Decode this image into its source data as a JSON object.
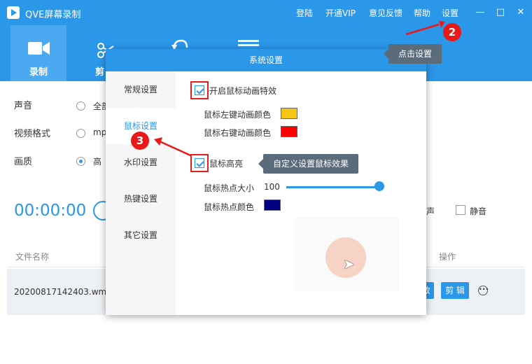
{
  "app": {
    "title": "QVE屏幕录制"
  },
  "top_links": {
    "login": "登陆",
    "vip": "开通VIP",
    "feedback": "意见反馈",
    "help": "帮助",
    "settings": "设置"
  },
  "window_controls": {
    "minimize": "—",
    "maximize": "□",
    "close": "✕"
  },
  "toolbar": {
    "record_label": "录制",
    "edit_label_partial": "剪"
  },
  "settings_left": {
    "sound_label": "声音",
    "sound_option": "全部",
    "format_label": "视频格式",
    "format_option": "mp",
    "quality_label": "画质",
    "quality_option": "高"
  },
  "timer": "00:00:00",
  "audio": {
    "partial_label": "声",
    "mute_label": "静音"
  },
  "file_list": {
    "header_name": "文件名称",
    "header_action": "操作",
    "rows": [
      {
        "name": "20200817142403.wmv",
        "btn_partial": "改",
        "edit_btn": "剪 辑"
      }
    ]
  },
  "dialog": {
    "title": "系统设置",
    "nav": [
      "常规设置",
      "鼠标设置",
      "水印设置",
      "热键设置",
      "其它设置"
    ],
    "active_nav": 1,
    "mouse_animation_label": "开启鼠标动画特效",
    "left_click_color_label": "鼠标左键动画颜色",
    "right_click_color_label": "鼠标右键动画颜色",
    "highlight_label": "鼠标高亮",
    "hotspot_size_label": "鼠标热点大小",
    "hotspot_size_value": "100",
    "hotspot_color_label": "鼠标热点颜色",
    "colors": {
      "left_click": "#f5c518",
      "right_click": "#ff0000",
      "hotspot": "#000080"
    }
  },
  "tooltips": {
    "click_settings": "点击设置",
    "custom_mouse": "自定义设置鼠标效果"
  },
  "badges": {
    "step2": "2",
    "step3": "3"
  },
  "colors": {
    "accent": "#2b97e8",
    "annotation": "#e81919"
  }
}
